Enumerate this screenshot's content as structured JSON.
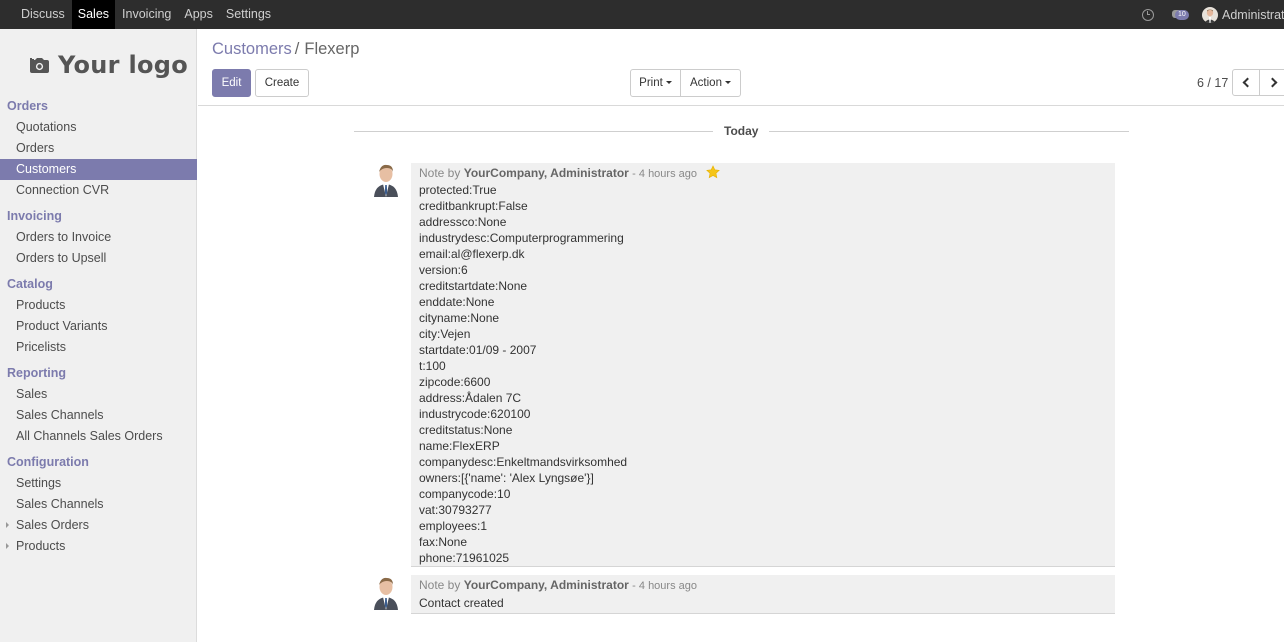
{
  "topbar": {
    "menu": [
      "Discuss",
      "Sales",
      "Invoicing",
      "Apps",
      "Settings"
    ],
    "active": "Sales",
    "messages_count": "10",
    "user_name": "Administrator"
  },
  "sidebar": {
    "logo_text": "Your logo",
    "sections": [
      {
        "title": "Orders",
        "items": [
          "Quotations",
          "Orders",
          "Customers",
          "Connection CVR"
        ]
      },
      {
        "title": "Invoicing",
        "items": [
          "Orders to Invoice",
          "Orders to Upsell"
        ]
      },
      {
        "title": "Catalog",
        "items": [
          "Products",
          "Product Variants",
          "Pricelists"
        ]
      },
      {
        "title": "Reporting",
        "items": [
          "Sales",
          "Sales Channels",
          "All Channels Sales Orders"
        ]
      },
      {
        "title": "Configuration",
        "items": [
          "Settings",
          "Sales Channels",
          "Sales Orders",
          "Products"
        ]
      }
    ],
    "active_item": "Customers",
    "collapsible_items": [
      "Sales Orders",
      "Products"
    ]
  },
  "control": {
    "breadcrumb_parent": "Customers",
    "breadcrumb_separator": "/",
    "breadcrumb_current": "Flexerp",
    "edit_label": "Edit",
    "create_label": "Create",
    "print_label": "Print",
    "action_label": "Action",
    "pager": "6 / 17"
  },
  "chatter": {
    "day_label": "Today",
    "messages": [
      {
        "prefix": "Note by",
        "author": "YourCompany, Administrator",
        "when": "- 4 hours ago",
        "starred": true,
        "lines": [
          "protected:True",
          "creditbankrupt:False",
          "addressco:None",
          "industrydesc:Computerprogrammering",
          "email:al@flexerp.dk",
          "version:6",
          "creditstartdate:None",
          "enddate:None",
          "cityname:None",
          "city:Vejen",
          "startdate:01/09 - 2007",
          "t:100",
          "zipcode:6600",
          "address:Ådalen 7C",
          "industrycode:620100",
          "creditstatus:None",
          "name:FlexERP",
          "companydesc:Enkeltmandsvirksomhed",
          "owners:[{'name': 'Alex Lyngsøe'}]",
          "companycode:10",
          "vat:30793277",
          "employees:1",
          "fax:None",
          "phone:71961025"
        ]
      },
      {
        "prefix": "Note by",
        "author": "YourCompany, Administrator",
        "when": "- 4 hours ago",
        "starred": false,
        "lines": [
          "Contact created"
        ]
      }
    ]
  },
  "colors": {
    "accent": "#7c7bad",
    "topbar": "#2d2d2d",
    "star": "#f5c518"
  }
}
